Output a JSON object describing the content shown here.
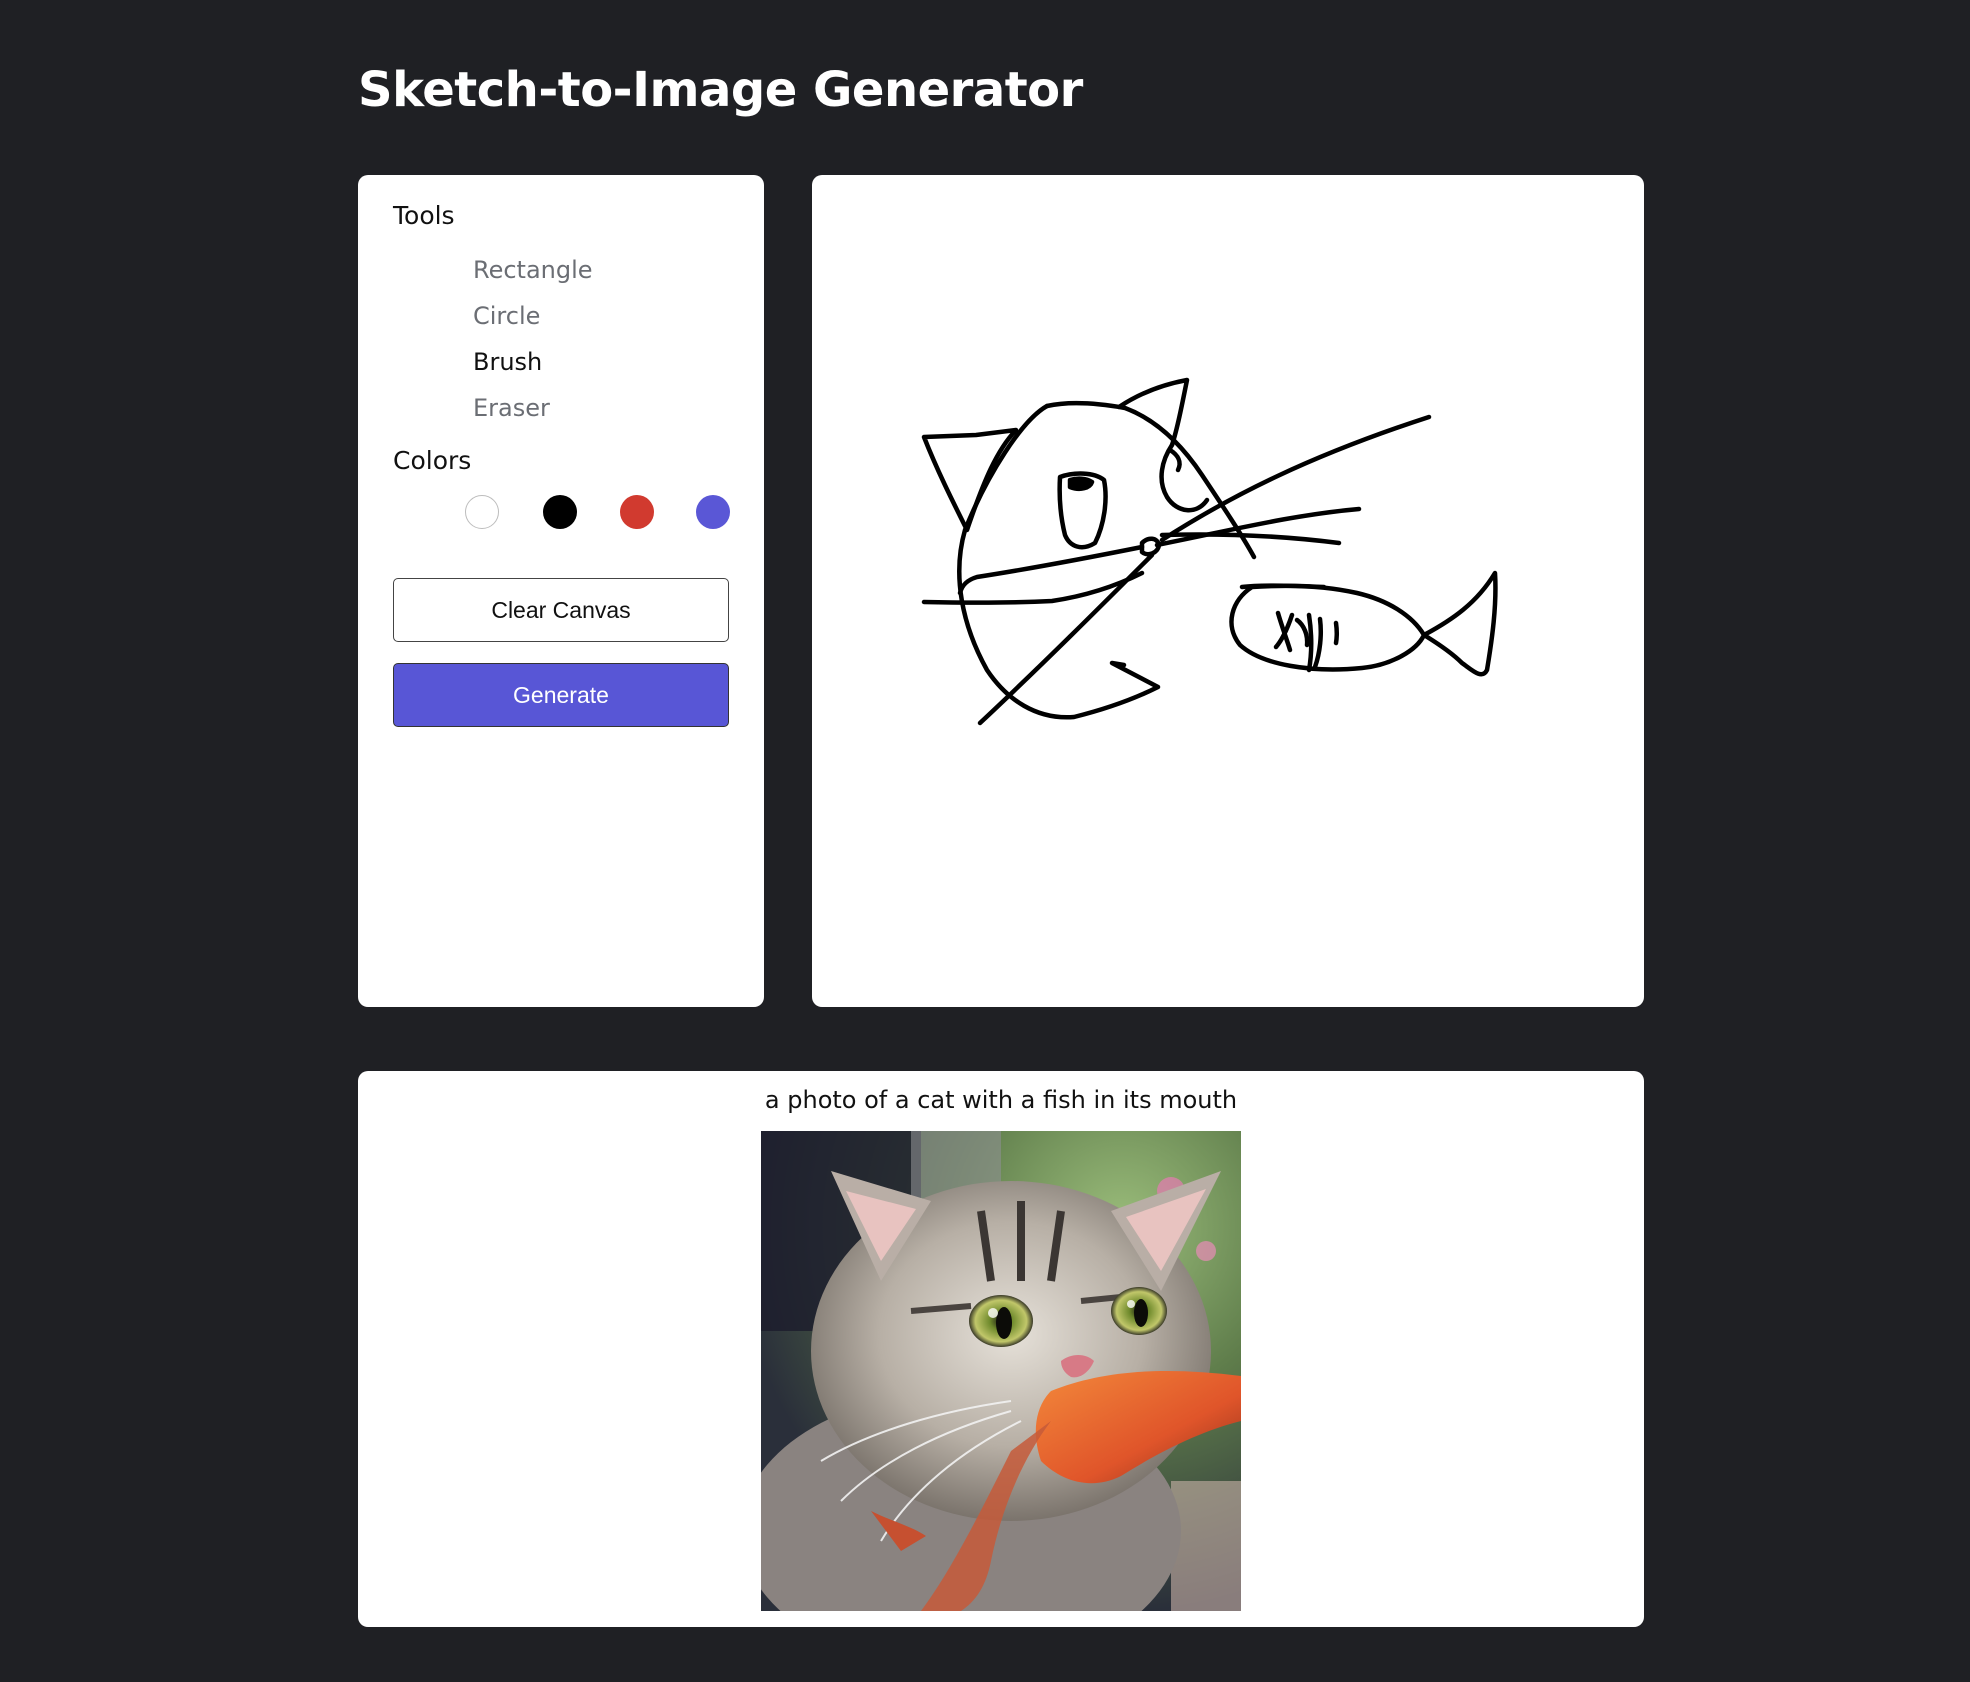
{
  "page": {
    "title": "Sketch-to-Image Generator"
  },
  "tools_panel": {
    "tools_label": "Tools",
    "tools": [
      {
        "label": "Rectangle",
        "active": false
      },
      {
        "label": "Circle",
        "active": false
      },
      {
        "label": "Brush",
        "active": true
      },
      {
        "label": "Eraser",
        "active": false
      }
    ],
    "colors_label": "Colors",
    "colors": [
      "#ffffff",
      "#000000",
      "#d13a2f",
      "#5a57d6"
    ],
    "clear_label": "Clear Canvas",
    "generate_label": "Generate"
  },
  "canvas": {
    "stroke_color": "#000000"
  },
  "result": {
    "prompt": "a photo of a cat with a fish in its mouth",
    "image_subject": "cat holding an orange fish in its mouth"
  },
  "theme": {
    "background": "#1f2024",
    "accent": "#5856d6"
  }
}
